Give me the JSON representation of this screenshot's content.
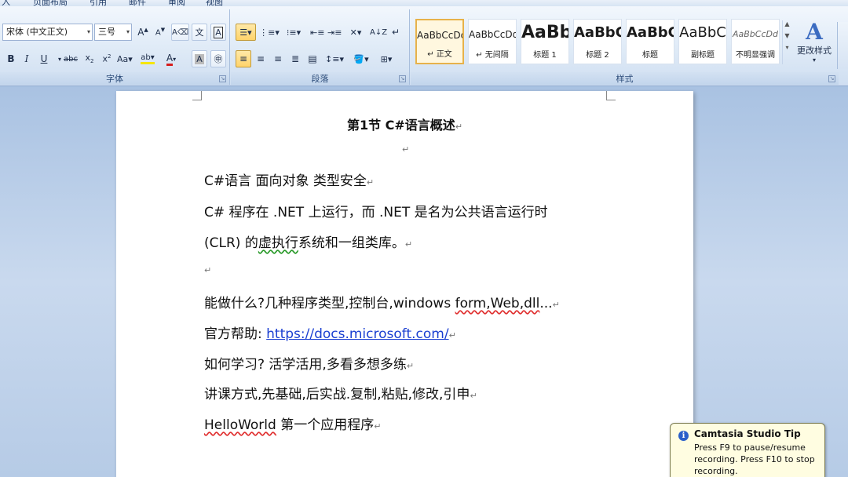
{
  "ribbon": {
    "tabs": [
      "入",
      "页面布局",
      "引用",
      "邮件",
      "审阅",
      "视图"
    ],
    "font": {
      "family_value": "宋体 (中文正文)",
      "size_value": "三号",
      "label": "字体"
    },
    "paragraph": {
      "label": "段落"
    },
    "styles": {
      "label": "样式",
      "tiles": [
        {
          "sample": "AaBbCcDd",
          "name": "↵ 正文",
          "selected": true
        },
        {
          "sample": "AaBbCcDd",
          "name": "↵ 无间隔",
          "selected": false
        },
        {
          "sample": "AaBb",
          "name": "标题 1",
          "selected": false
        },
        {
          "sample": "AaBbC",
          "name": "标题 2",
          "selected": false
        },
        {
          "sample": "AaBbC",
          "name": "标题",
          "selected": false
        },
        {
          "sample": "AaBbC",
          "name": "副标题",
          "selected": false
        },
        {
          "sample": "AaBbCcDd",
          "name": "不明显强调",
          "selected": false
        }
      ],
      "change_label": "更改样式"
    }
  },
  "document": {
    "title": "第1节   C#语言概述",
    "lines": {
      "l1": "C#语言  面向对象    类型安全",
      "l2": "C#  程序在  .NET  上运行，而  .NET  是名为公共语言运行时",
      "l3_pre": "(CLR)  的",
      "l3_sq": "虚执行",
      "l3_post": "系统和一组类库。",
      "l5_pre": "能做什么?几种程序类型,控制台,windows  ",
      "l5_sq": "form,Web,dll",
      "l5_post": "...",
      "l6_label": "官方帮助: ",
      "l6_link": "https://docs.microsoft.com/",
      "l7": "如何学习?    活学活用,多看多想多练",
      "l8": "讲课方式,先基础,后实战.复制,粘贴,修改,引申",
      "l9_sq": "HelloWorld",
      "l9_post": "    第一个应用程序"
    },
    "para_mark": "↵"
  },
  "tip": {
    "title": "Camtasia Studio Tip",
    "body": "Press F9 to pause/resume recording.  Press F10 to stop recording."
  }
}
